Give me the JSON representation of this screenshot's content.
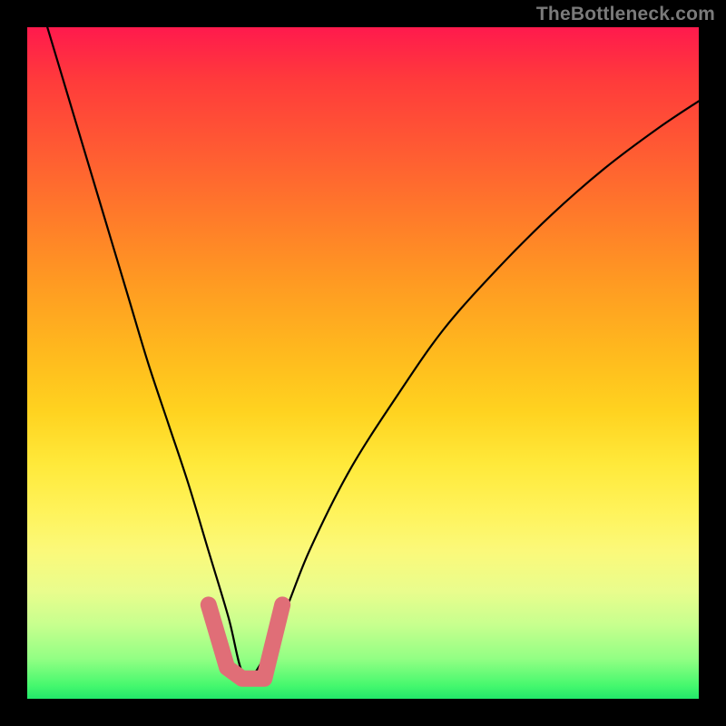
{
  "watermark": "TheBottleneck.com",
  "chart_data": {
    "type": "line",
    "title": "",
    "xlabel": "",
    "ylabel": "",
    "xlim": [
      0,
      100
    ],
    "ylim": [
      0,
      100
    ],
    "curve": {
      "minimum_x": 32,
      "series_x": [
        3,
        6,
        9,
        12,
        15,
        18,
        21,
        24,
        27,
        30,
        32,
        34,
        38,
        42,
        48,
        55,
        62,
        70,
        78,
        86,
        94,
        100
      ],
      "series_y": [
        100,
        90,
        80,
        70,
        60,
        50,
        41,
        32,
        22,
        12,
        4,
        4,
        12,
        22,
        34,
        45,
        55,
        64,
        72,
        79,
        85,
        89
      ]
    },
    "highlight_band": {
      "x_start": 27,
      "x_end": 38,
      "y_bottom": 3,
      "y_top": 14,
      "color": "#e06e77"
    },
    "gradient_stops": [
      {
        "pos": 0,
        "color": "#ff1a4d"
      },
      {
        "pos": 18,
        "color": "#ff5a33"
      },
      {
        "pos": 48,
        "color": "#ffb81e"
      },
      {
        "pos": 72,
        "color": "#fff35a"
      },
      {
        "pos": 100,
        "color": "#22e96a"
      }
    ]
  }
}
